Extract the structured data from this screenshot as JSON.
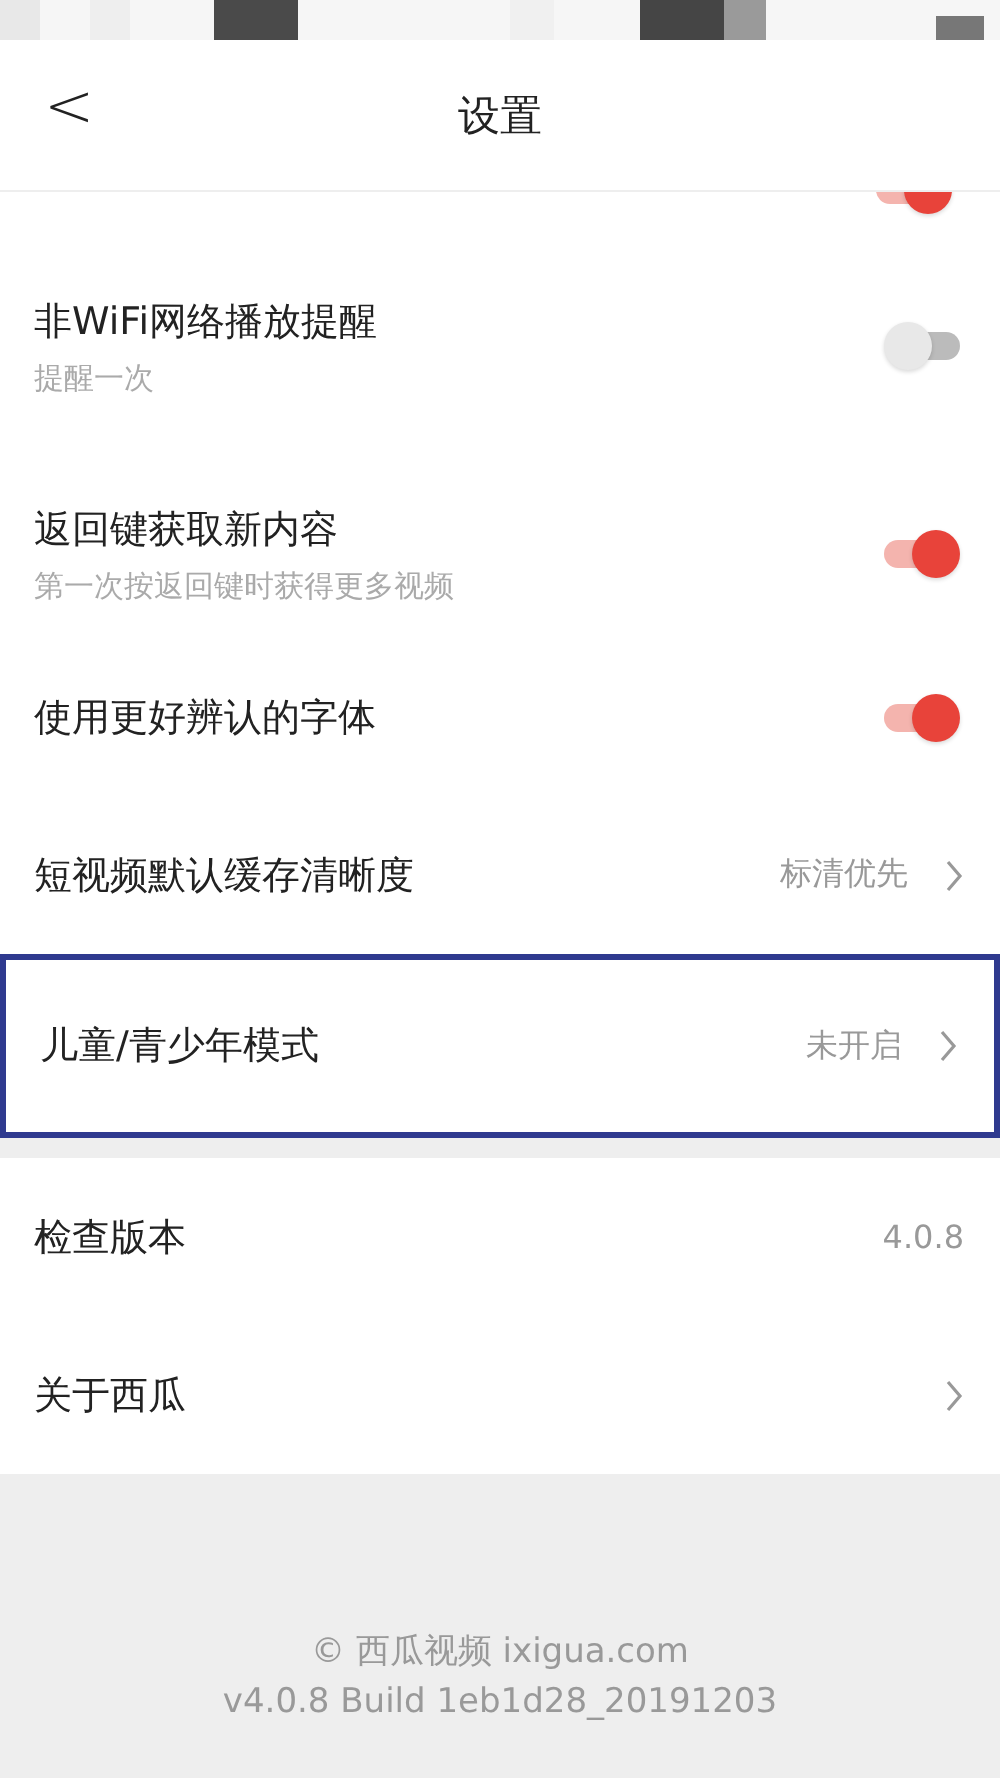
{
  "header": {
    "back": "<",
    "title": "设置"
  },
  "partial_row": {
    "on": true
  },
  "items": [
    {
      "kind": "toggle",
      "label": "非WiFi网络播放提醒",
      "sub": "提醒一次",
      "on": false,
      "highlighted": false
    },
    {
      "kind": "toggle",
      "label": "返回键获取新内容",
      "sub": "第一次按返回键时获得更多视频",
      "on": true,
      "highlighted": false
    },
    {
      "kind": "toggle",
      "label": "使用更好辨认的字体",
      "on": true,
      "highlighted": false
    },
    {
      "kind": "link",
      "label": "短视频默认缓存清晰度",
      "value": "标清优先",
      "highlighted": false
    },
    {
      "kind": "link",
      "label": "儿童/青少年模式",
      "value": "未开启",
      "highlighted": true
    },
    {
      "kind": "gap"
    },
    {
      "kind": "value",
      "label": "检查版本",
      "value": "4.0.8",
      "highlighted": false
    },
    {
      "kind": "link",
      "label": "关于西瓜",
      "highlighted": false
    }
  ],
  "footer": {
    "copyright": "© 西瓜视频 ixigua.com",
    "build": "v4.0.8 Build 1eb1d28_20191203"
  }
}
